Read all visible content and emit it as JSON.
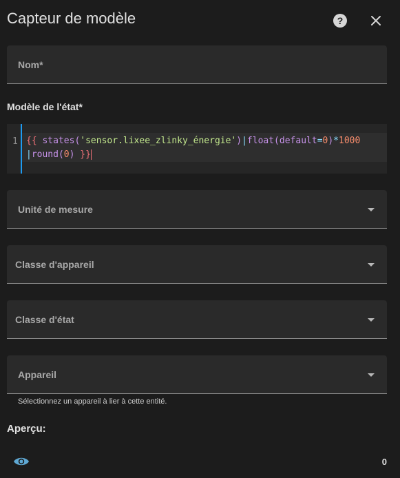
{
  "dialog": {
    "title": "Capteur de modèle",
    "help_icon": "help-circle-icon",
    "close_icon": "close-icon"
  },
  "name_field": {
    "label": "Nom*",
    "value": ""
  },
  "state_template": {
    "label": "Modèle de l'état*",
    "line_number": "1",
    "tokens_line1": [
      "{{",
      " states(",
      "'sensor.lixee_zlinky_énergie'",
      ")",
      "|",
      "float(",
      "default",
      "=",
      "0",
      ")",
      "*",
      "1000"
    ],
    "tokens_line2": [
      "|",
      "round(",
      "0",
      ") ",
      "}}"
    ]
  },
  "unit_field": {
    "label": "Unité de mesure",
    "value": ""
  },
  "device_class_field": {
    "label": "Classe d'appareil",
    "value": ""
  },
  "state_class_field": {
    "label": "Classe d'état",
    "value": ""
  },
  "device_field": {
    "label": "Appareil",
    "value": "",
    "helper": "Sélectionnez un appareil à lier à cette entité."
  },
  "preview": {
    "label": "Aperçu:",
    "icon": "eye-icon",
    "value": "0"
  },
  "colors": {
    "accent": "#1e9bf0",
    "background": "#1c1c1c",
    "field": "#2a2a2a"
  }
}
